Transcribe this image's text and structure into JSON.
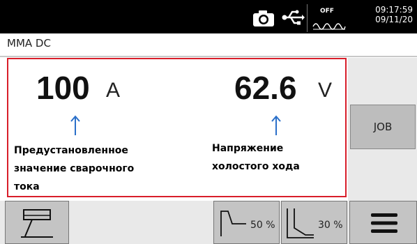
{
  "status_bar": {
    "vrd_label": "OFF",
    "time": "09:17:59",
    "date": "09/11/20",
    "icons": [
      "camera-icon",
      "usb-icon",
      "vrd-wave-icon"
    ]
  },
  "mode": "MMA DC",
  "current": {
    "value": "100",
    "unit": "A",
    "annotation_lines": [
      "Предустановленное",
      "значение сварочного",
      "тока"
    ]
  },
  "voltage": {
    "value": "62.6",
    "unit": "V",
    "annotation_lines": [
      "Напряжение",
      "холостого хода"
    ]
  },
  "side_buttons": {
    "job_label": "JOB"
  },
  "bottom_buttons": {
    "torch_icon": "electrode-holder-icon",
    "hot_start_percent": "50 %",
    "hot_start_icon": "hot-start-icon",
    "arc_force_percent": "30 %",
    "arc_force_icon": "arc-force-icon",
    "menu_icon": "hamburger-menu-icon"
  },
  "colors": {
    "highlight_border": "#d81e2a",
    "annotation_arrow": "#2a6fc9",
    "top_bar": "#000000",
    "button": "#c4c4c4"
  }
}
